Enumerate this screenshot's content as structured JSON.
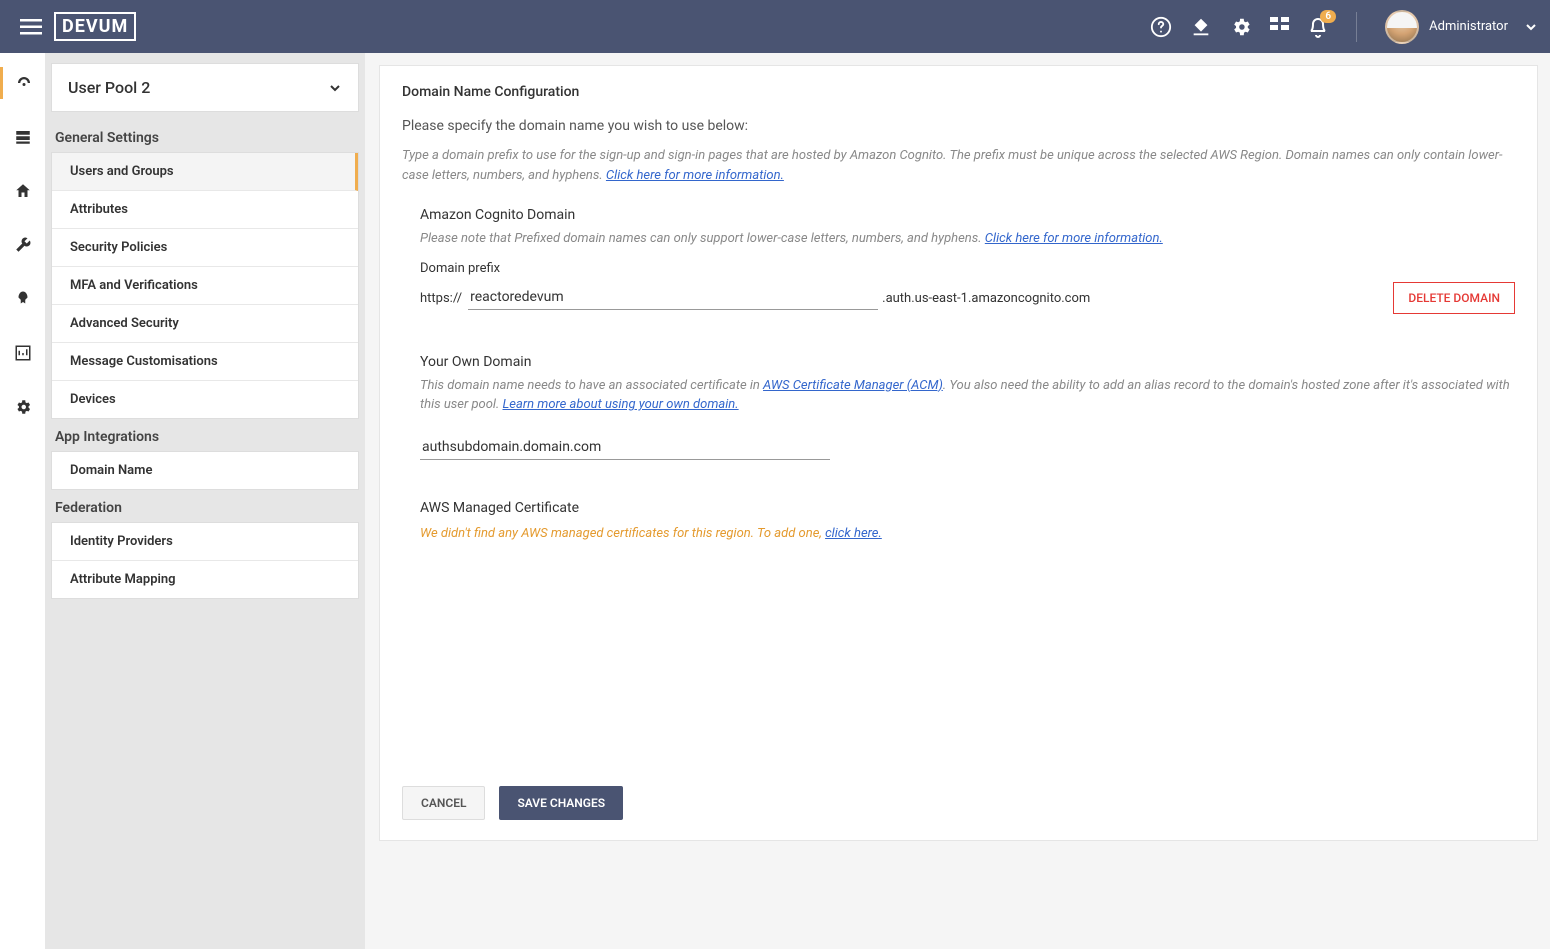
{
  "header": {
    "logo_text": "DEVUM",
    "notification_badge": "6",
    "user_name": "Administrator"
  },
  "sidebar": {
    "pool_select": "User Pool 2",
    "sections": [
      {
        "title": "General Settings",
        "items": [
          "Users and Groups",
          "Attributes",
          "Security Policies",
          "MFA and Verifications",
          "Advanced Security",
          "Message Customisations",
          "Devices"
        ],
        "active_index": 0
      },
      {
        "title": "App Integrations",
        "items": [
          "Domain Name"
        ],
        "active_index": -1
      },
      {
        "title": "Federation",
        "items": [
          "Identity Providers",
          "Attribute Mapping"
        ],
        "active_index": -1
      }
    ]
  },
  "content": {
    "title": "Domain Name Configuration",
    "lead": "Please specify the domain name you wish to use below:",
    "help_prefix": "Type a domain prefix to use for the sign-up and sign-in pages that are hosted by Amazon Cognito. The prefix must be unique across the selected AWS Region. Domain names can only contain lower-case letters, numbers, and hyphens. ",
    "help_link": "Click here for more information.",
    "cognito": {
      "title": "Amazon Cognito Domain",
      "help": "Please note that Prefixed domain names can only support lower-case letters, numbers, and hyphens. ",
      "help_link": "Click here for more information.",
      "field_label": "Domain prefix",
      "https": "https://",
      "value": "reactoredevum",
      "suffix": ".auth.us-east-1.amazoncognito.com",
      "delete_btn": "DELETE DOMAIN"
    },
    "own": {
      "title": "Your Own Domain",
      "help1": "This domain name needs to have an associated certificate in ",
      "acm_link": "AWS Certificate Manager (ACM)",
      "help2": ". You also need the ability to add an alias record to the domain's hosted zone after it's associated with this user pool. ",
      "learn_link": "Learn more about using your own domain.",
      "value": "authsubdomain.domain.com"
    },
    "cert": {
      "title": "AWS Managed Certificate",
      "warning": "We didn't find any AWS managed certificates for this region. To add one, ",
      "link": "click here."
    },
    "footer": {
      "cancel": "CANCEL",
      "save": "SAVE CHANGES"
    }
  }
}
